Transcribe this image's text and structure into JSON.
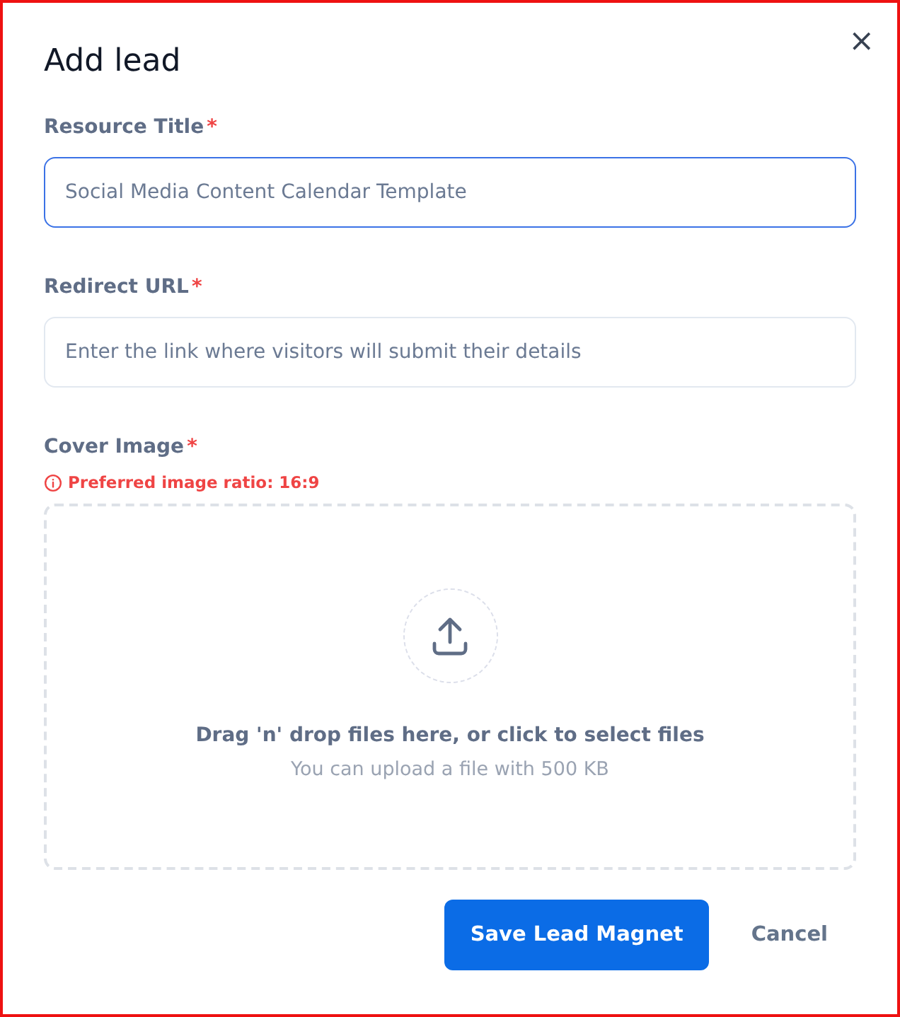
{
  "dialog": {
    "title": "Add lead",
    "close": "×"
  },
  "fields": [
    {
      "kind": "text",
      "label": "Resource Title",
      "required_mark": "*",
      "placeholder": "Social Media Content Calendar Template",
      "focused": true
    },
    {
      "kind": "text",
      "label": "Redirect URL",
      "required_mark": "*",
      "placeholder": "Enter the link where visitors will submit their details",
      "focused": false
    },
    {
      "kind": "upload",
      "label": "Cover Image",
      "required_mark": "*",
      "hint": "Preferred image ratio: 16:9",
      "prompt": "Drag 'n' drop files here, or click to select files",
      "note": "You can upload a file with 500 KB"
    }
  ],
  "buttons": [
    {
      "kind": "primary",
      "label": "Save Lead Magnet"
    },
    {
      "kind": "plain",
      "label": "Cancel"
    }
  ]
}
